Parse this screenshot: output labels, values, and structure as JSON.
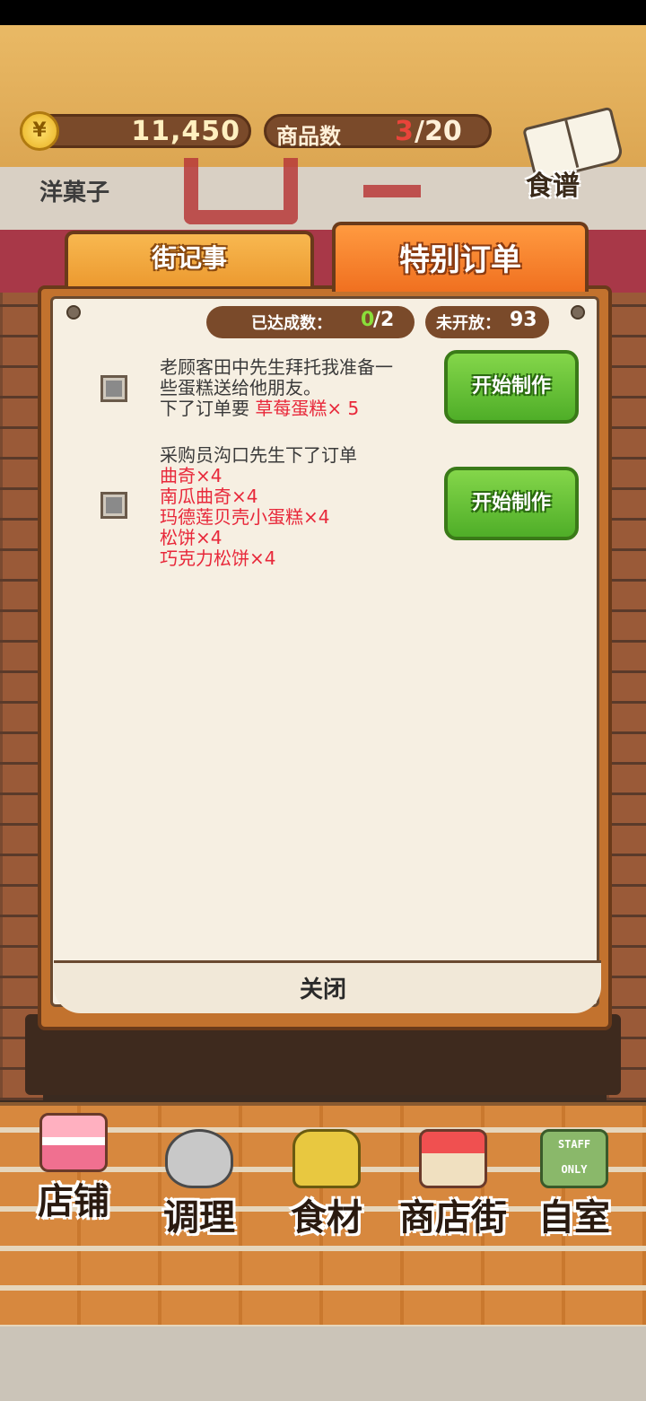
{
  "header": {
    "currency_symbol": "¥",
    "money": "11,450",
    "goods_label": "商品数",
    "goods_current": "3",
    "goods_total": "/20",
    "recipe_label": "食谱"
  },
  "storefront": {
    "sign_text": "洋菓子"
  },
  "tabs": [
    {
      "label": "街记事",
      "active": false
    },
    {
      "label": "特别订单",
      "active": true
    }
  ],
  "counters": {
    "achieved_label": "已达成数：",
    "achieved_current": "0",
    "achieved_total": "/2",
    "unopened_label": "未开放：",
    "unopened_count": "93"
  },
  "orders": [
    {
      "intro_lines": [
        "老顾客田中先生拜托我准备一",
        "些蛋糕送给他朋友。"
      ],
      "request_prefix": "下了订单要 ",
      "items": [
        "草莓蛋糕× 5"
      ],
      "button_label": "开始制作"
    },
    {
      "intro_lines": [
        "采购员沟口先生下了订单"
      ],
      "request_prefix": "",
      "items": [
        "曲奇×4",
        "南瓜曲奇×4",
        "玛德莲贝壳小蛋糕×4",
        "松饼×4",
        "巧克力松饼×4"
      ],
      "button_label": "开始制作"
    }
  ],
  "close_label": "关闭",
  "bottom_nav": [
    {
      "label": "店铺",
      "icon": "cake-icon"
    },
    {
      "label": "调理",
      "icon": "mixing-bowl-icon"
    },
    {
      "label": "食材",
      "icon": "flour-bag-icon"
    },
    {
      "label": "商店街",
      "icon": "storefront-icon"
    },
    {
      "label": "自室",
      "icon": "staff-door-icon"
    }
  ],
  "staff_sign": "STAFF ONLY",
  "colors": {
    "tab_active": "#f07020",
    "button_green": "#4fae28",
    "order_item_red": "#e8283a",
    "achieved_green": "#8ade3a"
  }
}
